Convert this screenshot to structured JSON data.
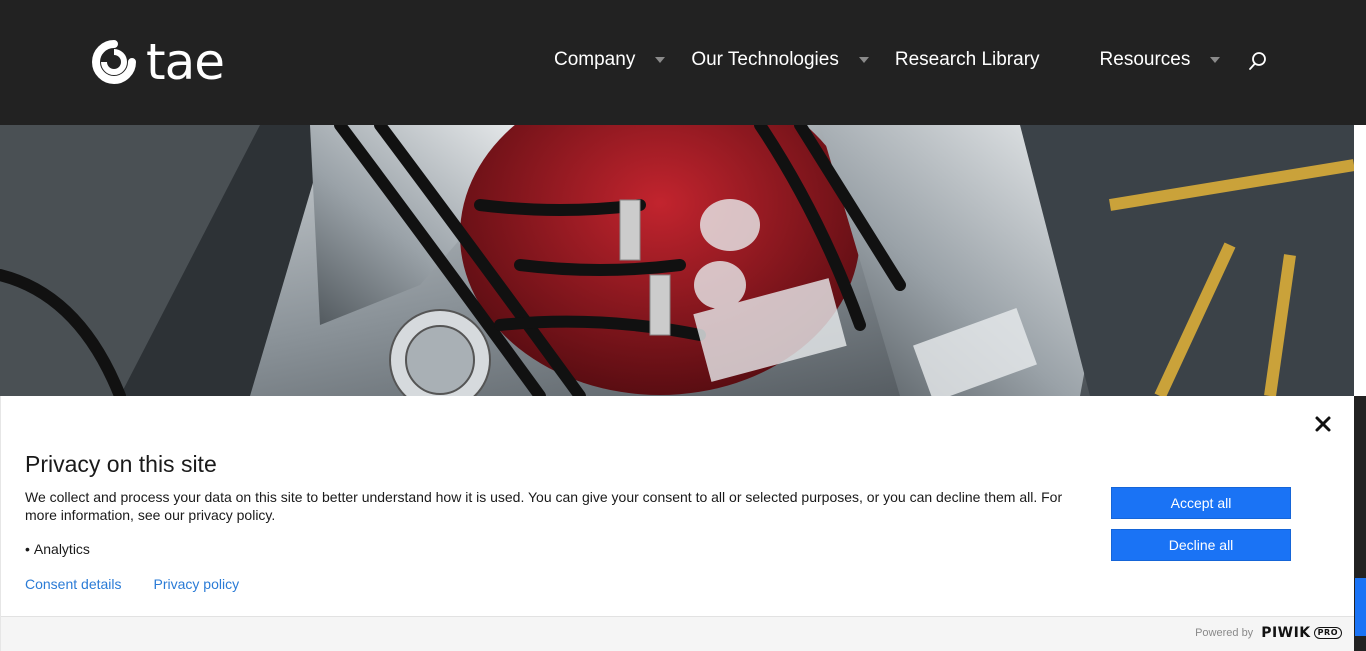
{
  "header": {
    "logo_text": "tae",
    "nav": [
      {
        "label": "Company",
        "has_dropdown": true
      },
      {
        "label": "Our Technologies",
        "has_dropdown": true
      },
      {
        "label": "Research Library",
        "has_dropdown": false
      },
      {
        "label": "Resources",
        "has_dropdown": true
      }
    ],
    "search_icon": "search-icon"
  },
  "consent": {
    "title": "Privacy on this site",
    "text": "We collect and process your data on this site to better understand how it is used. You can give your consent to all or selected purposes, or you can decline them all. For more information, see our privacy policy.",
    "purposes": [
      "Analytics"
    ],
    "links": {
      "consent_details": "Consent details",
      "privacy_policy": "Privacy policy"
    },
    "accept_label": "Accept all",
    "decline_label": "Decline all",
    "close_icon": "close-icon",
    "powered_by": "Powered by",
    "brand": "PIWIK",
    "brand_badge": "PRO"
  },
  "colors": {
    "header_bg": "#222222",
    "button_blue": "#1a73f5",
    "link_blue": "#2a7bd6"
  }
}
